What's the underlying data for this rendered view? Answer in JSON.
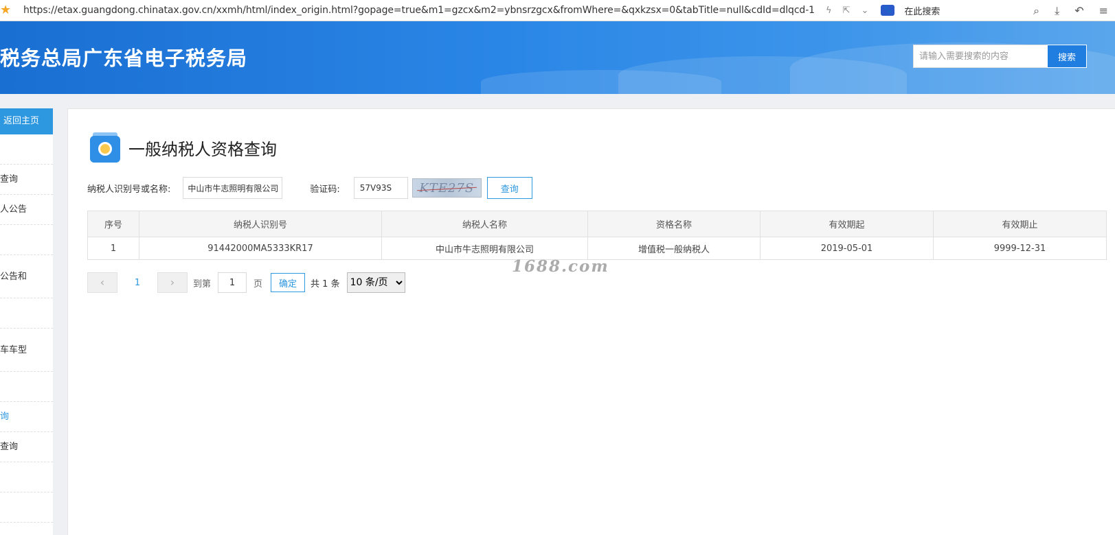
{
  "browser": {
    "url": "https://etax.guangdong.chinatax.gov.cn/xxmh/html/index_origin.html?gopage=true&m1=gzcx&m2=ybnsrzgcx&fromWhere=&qxkzsx=0&tabTitle=null&cdId=dlqcd-1",
    "search_label": "在此搜索"
  },
  "banner": {
    "title": "税务总局广东省电子税务局",
    "search_placeholder": "请输入需要搜索的内容",
    "search_button": "搜索"
  },
  "sidebar": {
    "home_label": "返回主页",
    "items": [
      {
        "label": ""
      },
      {
        "label": "查询"
      },
      {
        "label": "人公告"
      },
      {
        "label": ""
      },
      {
        "label": "公告和"
      },
      {
        "label": ""
      },
      {
        "label": "车车型"
      },
      {
        "label": ""
      },
      {
        "label": "询"
      },
      {
        "label": "查询"
      },
      {
        "label": ""
      },
      {
        "label": ""
      }
    ]
  },
  "page": {
    "title": "一般纳税人资格查询"
  },
  "form": {
    "taxpayer_label": "纳税人识别号或名称:",
    "taxpayer_value": "中山市牛志照明有限公司",
    "captcha_label": "验证码:",
    "captcha_value": "57V93S",
    "captcha_image_text": "KTE27S",
    "query_button": "查询"
  },
  "table": {
    "headers": [
      "序号",
      "纳税人识别号",
      "纳税人名称",
      "资格名称",
      "有效期起",
      "有效期止"
    ],
    "rows": [
      [
        "1",
        "91442000MA5333KR17",
        "中山市牛志照明有限公司",
        "增值税一般纳税人",
        "2019-05-01",
        "9999-12-31"
      ]
    ]
  },
  "pagination": {
    "current_page": "1",
    "goto_label": "到第",
    "goto_value": "1",
    "page_unit": "页",
    "confirm_label": "确定",
    "total_label": "共 1 条",
    "page_size": "10 条/页"
  },
  "watermark": "1688.com"
}
